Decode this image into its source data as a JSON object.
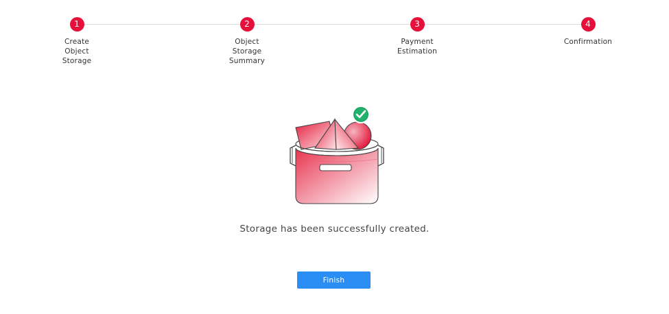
{
  "stepper": {
    "steps": [
      {
        "number": "1",
        "label": "Create\nObject\nStorage"
      },
      {
        "number": "2",
        "label": "Object\nStorage\nSummary"
      },
      {
        "number": "3",
        "label": "Payment\nEstimation"
      },
      {
        "number": "4",
        "label": "Confirmation"
      }
    ],
    "active_color": "#e5113a"
  },
  "illustration": {
    "icon": "bucket-with-shapes-icon",
    "badge_icon": "success-check-icon",
    "badge_color": "#21b36b"
  },
  "main": {
    "message": "Storage has been successfully created."
  },
  "actions": {
    "finish_label": "Finish",
    "finish_color": "#2a8ef5"
  }
}
